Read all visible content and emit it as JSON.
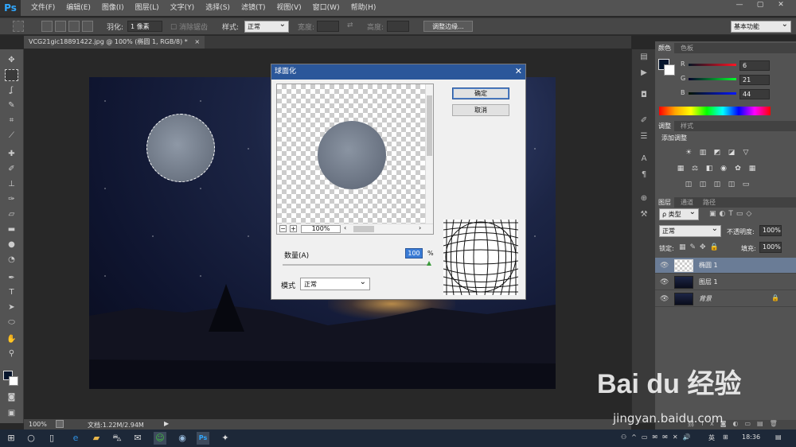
{
  "app": {
    "logo": "Ps"
  },
  "menu": [
    "文件(F)",
    "编辑(E)",
    "图像(I)",
    "图层(L)",
    "文字(Y)",
    "选择(S)",
    "滤镜(T)",
    "视图(V)",
    "窗口(W)",
    "帮助(H)"
  ],
  "window_controls": [
    "—",
    "▢",
    "✕"
  ],
  "options": {
    "feather_label": "羽化:",
    "feather_value": "1 像素",
    "antialias_label": "消除锯齿",
    "style_label": "样式:",
    "style_value": "正常",
    "width_label": "宽度:",
    "height_label": "高度:",
    "refine_edge": "调整边缘...",
    "workspace": "基本功能"
  },
  "document": {
    "tab_title": "VCG21gic18891422.jpg @ 100% (椭圆 1, RGB/8) *",
    "tab_close": "×"
  },
  "status": {
    "zoom": "100%",
    "doc_info": "文档:1.22M/2.94M"
  },
  "color_panel": {
    "tabs": [
      "颜色",
      "色板"
    ],
    "R": {
      "label": "R",
      "value": "6"
    },
    "G": {
      "label": "G",
      "value": "21"
    },
    "B": {
      "label": "B",
      "value": "44"
    }
  },
  "adjustments_panel": {
    "tabs": [
      "调整",
      "样式"
    ],
    "add_label": "添加调整"
  },
  "layers_panel": {
    "tabs": [
      "图层",
      "通道",
      "路径"
    ],
    "filter_label": "ρ 类型",
    "blend_mode": "正常",
    "opacity_label": "不透明度:",
    "opacity_value": "100%",
    "lock_label": "锁定:",
    "fill_label": "填充:",
    "fill_value": "100%",
    "layers": [
      {
        "name": "椭圆 1",
        "selected": true
      },
      {
        "name": "图层 1",
        "selected": false
      },
      {
        "name": "背景",
        "selected": false
      }
    ]
  },
  "dialog": {
    "title": "球面化",
    "close": "✕",
    "ok": "确定",
    "cancel": "取消",
    "zoom": "100%",
    "amount_label": "数量(A)",
    "amount_value": "100",
    "amount_unit": "%",
    "mode_label": "模式",
    "mode_value": "正常"
  },
  "taskbar": {
    "ime": "英",
    "time": "18:36"
  },
  "watermark": {
    "brand": "Bai du 经验",
    "url": "jingyan.baidu.com"
  },
  "colors": {
    "accent_blue": "#2b579a",
    "selected_layer": "#6a7c96",
    "ps_blue": "#31a8ff"
  }
}
